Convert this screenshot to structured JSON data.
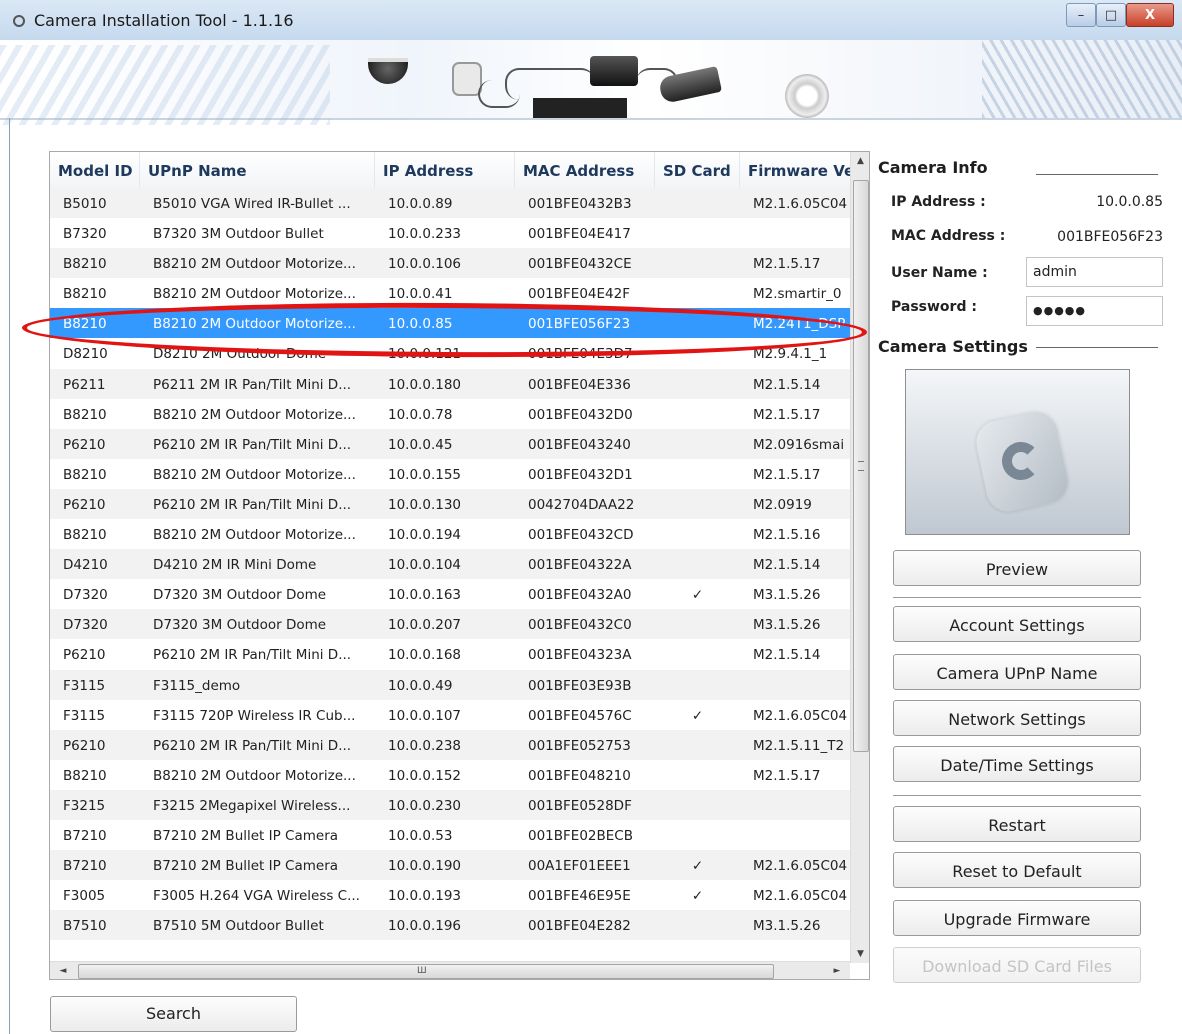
{
  "window": {
    "title": "Camera Installation Tool - 1.1.16",
    "controls": {
      "minimize": "–",
      "maximize": "□",
      "close": "X"
    }
  },
  "table": {
    "headers": [
      "Model ID",
      "UPnP Name",
      "IP Address",
      "MAC Address",
      "SD Card",
      "Firmware Ve"
    ],
    "selected_row_index": 4,
    "rows": [
      [
        "B5010",
        "B5010 VGA Wired IR-Bullet ...",
        "10.0.0.89",
        "001BFE0432B3",
        "",
        "M2.1.6.05C04"
      ],
      [
        "B7320",
        "B7320 3M Outdoor Bullet",
        "10.0.0.233",
        "001BFE04E417",
        "",
        ""
      ],
      [
        "B8210",
        "B8210 2M Outdoor Motorize...",
        "10.0.0.106",
        "001BFE0432CE",
        "",
        "M2.1.5.17"
      ],
      [
        "B8210",
        "B8210 2M Outdoor Motorize...",
        "10.0.0.41",
        "001BFE04E42F",
        "",
        "M2.smartir_0"
      ],
      [
        "B8210",
        "B8210 2M Outdoor Motorize...",
        "10.0.0.85",
        "001BFE056F23",
        "",
        "M2.24T1_DSP"
      ],
      [
        "D8210",
        "D8210 2M Outdoor Dome",
        "10.0.0.121",
        "001BFE04E3D7",
        "",
        "M2.9.4.1_1"
      ],
      [
        "P6211",
        "P6211 2M IR Pan/Tilt Mini D...",
        "10.0.0.180",
        "001BFE04E336",
        "",
        "M2.1.5.14"
      ],
      [
        "B8210",
        "B8210 2M Outdoor Motorize...",
        "10.0.0.78",
        "001BFE0432D0",
        "",
        "M2.1.5.17"
      ],
      [
        "P6210",
        "P6210 2M IR Pan/Tilt Mini D...",
        "10.0.0.45",
        "001BFE043240",
        "",
        "M2.0916smai"
      ],
      [
        "B8210",
        "B8210 2M Outdoor Motorize...",
        "10.0.0.155",
        "001BFE0432D1",
        "",
        "M2.1.5.17"
      ],
      [
        "P6210",
        "P6210 2M IR Pan/Tilt Mini D...",
        "10.0.0.130",
        "0042704DAA22",
        "",
        "M2.0919"
      ],
      [
        "B8210",
        "B8210 2M Outdoor Motorize...",
        "10.0.0.194",
        "001BFE0432CD",
        "",
        "M2.1.5.16"
      ],
      [
        "D4210",
        "D4210 2M IR Mini Dome",
        "10.0.0.104",
        "001BFE04322A",
        "",
        "M2.1.5.14"
      ],
      [
        "D7320",
        "D7320 3M Outdoor Dome",
        "10.0.0.163",
        "001BFE0432A0",
        "✓",
        "M3.1.5.26"
      ],
      [
        "D7320",
        "D7320 3M Outdoor Dome",
        "10.0.0.207",
        "001BFE0432C0",
        "",
        "M3.1.5.26"
      ],
      [
        "P6210",
        "P6210 2M IR Pan/Tilt Mini D...",
        "10.0.0.168",
        "001BFE04323A",
        "",
        "M2.1.5.14"
      ],
      [
        "F3115",
        "F3115_demo",
        "10.0.0.49",
        "001BFE03E93B",
        "",
        ""
      ],
      [
        "F3115",
        "F3115 720P Wireless IR Cub...",
        "10.0.0.107",
        "001BFE04576C",
        "✓",
        "M2.1.6.05C04"
      ],
      [
        "P6210",
        "P6210 2M IR Pan/Tilt Mini D...",
        "10.0.0.238",
        "001BFE052753",
        "",
        "M2.1.5.11_T2"
      ],
      [
        "B8210",
        "B8210 2M Outdoor Motorize...",
        "10.0.0.152",
        "001BFE048210",
        "",
        "M2.1.5.17"
      ],
      [
        "F3215",
        "F3215 2Megapixel Wireless...",
        "10.0.0.230",
        "001BFE0528DF",
        "",
        ""
      ],
      [
        "B7210",
        "B7210 2M Bullet IP Camera",
        "10.0.0.53",
        "001BFE02BECB",
        "",
        ""
      ],
      [
        "B7210",
        "B7210 2M Bullet IP Camera",
        "10.0.0.190",
        "00A1EF01EEE1",
        "✓",
        "M2.1.6.05C04"
      ],
      [
        "F3005",
        "F3005 H.264 VGA Wireless C...",
        "10.0.0.193",
        "001BFE46E95E",
        "✓",
        "M2.1.6.05C04"
      ],
      [
        "B7510",
        "B7510 5M Outdoor Bullet",
        "10.0.0.196",
        "001BFE04E282",
        "",
        "M3.1.5.26"
      ]
    ]
  },
  "scroll": {
    "up": "▲",
    "down": "▼",
    "left": "◄",
    "right": "►",
    "grip_v": "≡",
    "grip_h": "Ш"
  },
  "search_label": "Search",
  "camera_info": {
    "title": "Camera Info",
    "ip_label": "IP Address :",
    "ip_value": "10.0.0.85",
    "mac_label": "MAC Address :",
    "mac_value": "001BFE056F23",
    "user_label": "User Name :",
    "user_value": "admin",
    "password_label": "Password :",
    "password_value": "●●●●●"
  },
  "camera_settings": {
    "title": "Camera Settings",
    "buttons": {
      "preview": "Preview",
      "account": "Account Settings",
      "upnp": "Camera UPnP Name",
      "network": "Network Settings",
      "datetime": "Date/Time Settings",
      "restart": "Restart",
      "reset": "Reset to Default",
      "upgrade": "Upgrade Firmware",
      "download_sd": "Download SD Card Files"
    }
  },
  "colors": {
    "selection": "#3399ff",
    "annotation": "#e11414",
    "header_text": "#1e395b"
  }
}
